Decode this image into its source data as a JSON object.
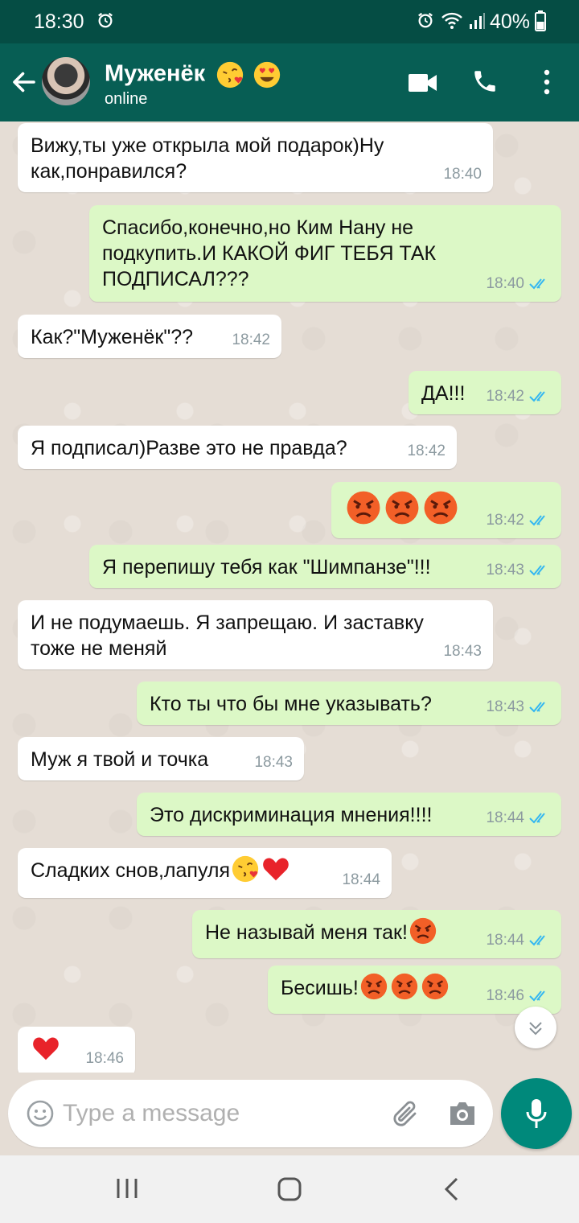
{
  "status_bar": {
    "time": "18:30",
    "battery": "40%"
  },
  "header": {
    "contact_name": "Муженёк",
    "contact_emojis": [
      "kiss-emoji",
      "heart-eyes-emoji"
    ],
    "status": "online"
  },
  "messages": [
    {
      "dir": "in",
      "text": "Вижу,ты уже открыла мой подарок)Ну\nкак,понравился?",
      "time": "18:40"
    },
    {
      "dir": "out",
      "text": "Спасибо,конечно,но Ким Нану не\nподкупить.И КАКОЙ ФИГ ТЕБЯ ТАК\nПОДПИСАЛ???",
      "time": "18:40"
    },
    {
      "dir": "in",
      "text": "Как?\"Муженёк\"??",
      "time": "18:42"
    },
    {
      "dir": "out",
      "text": "ДА!!!",
      "time": "18:42"
    },
    {
      "dir": "in",
      "text": "Я подписал)Разве это не правда?",
      "time": "18:42"
    },
    {
      "dir": "out",
      "text": "",
      "emojis": [
        "angry-emoji",
        "angry-emoji",
        "angry-emoji"
      ],
      "time": "18:42"
    },
    {
      "dir": "out",
      "text": "Я перепишу тебя как \"Шимпанзе\"!!!",
      "time": "18:43"
    },
    {
      "dir": "in",
      "text": "И не подумаешь. Я запрещаю. И заставку\nтоже не меняй",
      "time": "18:43"
    },
    {
      "dir": "out",
      "text": "Кто ты что бы мне указывать?",
      "time": "18:43"
    },
    {
      "dir": "in",
      "text": "Муж я твой и точка",
      "time": "18:43"
    },
    {
      "dir": "out",
      "text": "Это дискриминация мнения!!!!",
      "time": "18:44"
    },
    {
      "dir": "in",
      "text": "Сладких снов,лапуля",
      "emojis": [
        "kiss-emoji",
        "heart-emoji"
      ],
      "time": "18:44"
    },
    {
      "dir": "out",
      "text": "Не называй меня так!",
      "emojis": [
        "angry-emoji"
      ],
      "time": "18:44"
    },
    {
      "dir": "out",
      "text": "Бесишь!",
      "emojis": [
        "angry-emoji",
        "angry-emoji",
        "angry-emoji"
      ],
      "time": "18:46"
    },
    {
      "dir": "in",
      "text": "",
      "emojis": [
        "heart-emoji"
      ],
      "time": "18:46"
    }
  ],
  "composer": {
    "placeholder": "Type a message"
  },
  "colors": {
    "header": "#075e54",
    "statusbar": "#054d44",
    "outgoing": "#dcf8c6",
    "incoming": "#ffffff",
    "read_ticks": "#34b7f1",
    "mic": "#00897b"
  }
}
